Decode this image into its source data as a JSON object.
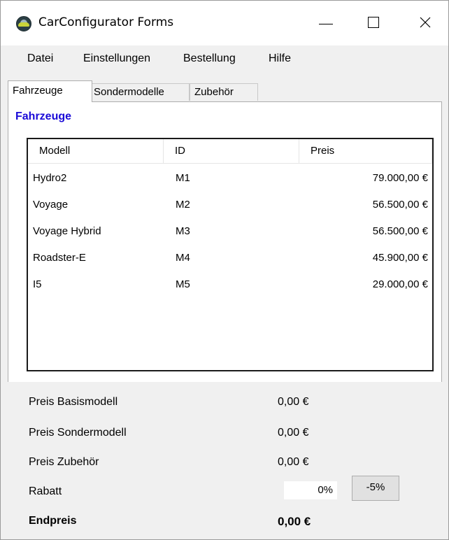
{
  "window": {
    "title": "CarConfigurator Forms"
  },
  "menu": [
    "Datei",
    "Einstellungen",
    "Bestellung",
    "Hilfe"
  ],
  "tabs": [
    "Fahrzeuge",
    "Sondermodelle",
    "Zubehör"
  ],
  "panel": {
    "heading": "Fahrzeuge",
    "columns": [
      "Modell",
      "ID",
      "Preis"
    ],
    "rows": [
      {
        "model": "Hydro2",
        "id": "M1",
        "price": "79.000,00 €"
      },
      {
        "model": "Voyage",
        "id": "M2",
        "price": "56.500,00 €"
      },
      {
        "model": "Voyage Hybrid",
        "id": "M3",
        "price": "56.500,00 €"
      },
      {
        "model": "Roadster-E",
        "id": "M4",
        "price": "45.900,00 €"
      },
      {
        "model": "I5",
        "id": "M5",
        "price": "29.000,00 €"
      }
    ]
  },
  "summary": {
    "base_label": "Preis Basismodell",
    "base_value": "0,00 €",
    "special_label": "Preis Sondermodell",
    "special_value": "0,00 €",
    "accessory_label": "Preis Zubehör",
    "accessory_value": "0,00 €",
    "discount_label": "Rabatt",
    "discount_value": "0%",
    "discount_button": "-5%",
    "total_label": "Endpreis",
    "total_value": "0,00 €"
  }
}
